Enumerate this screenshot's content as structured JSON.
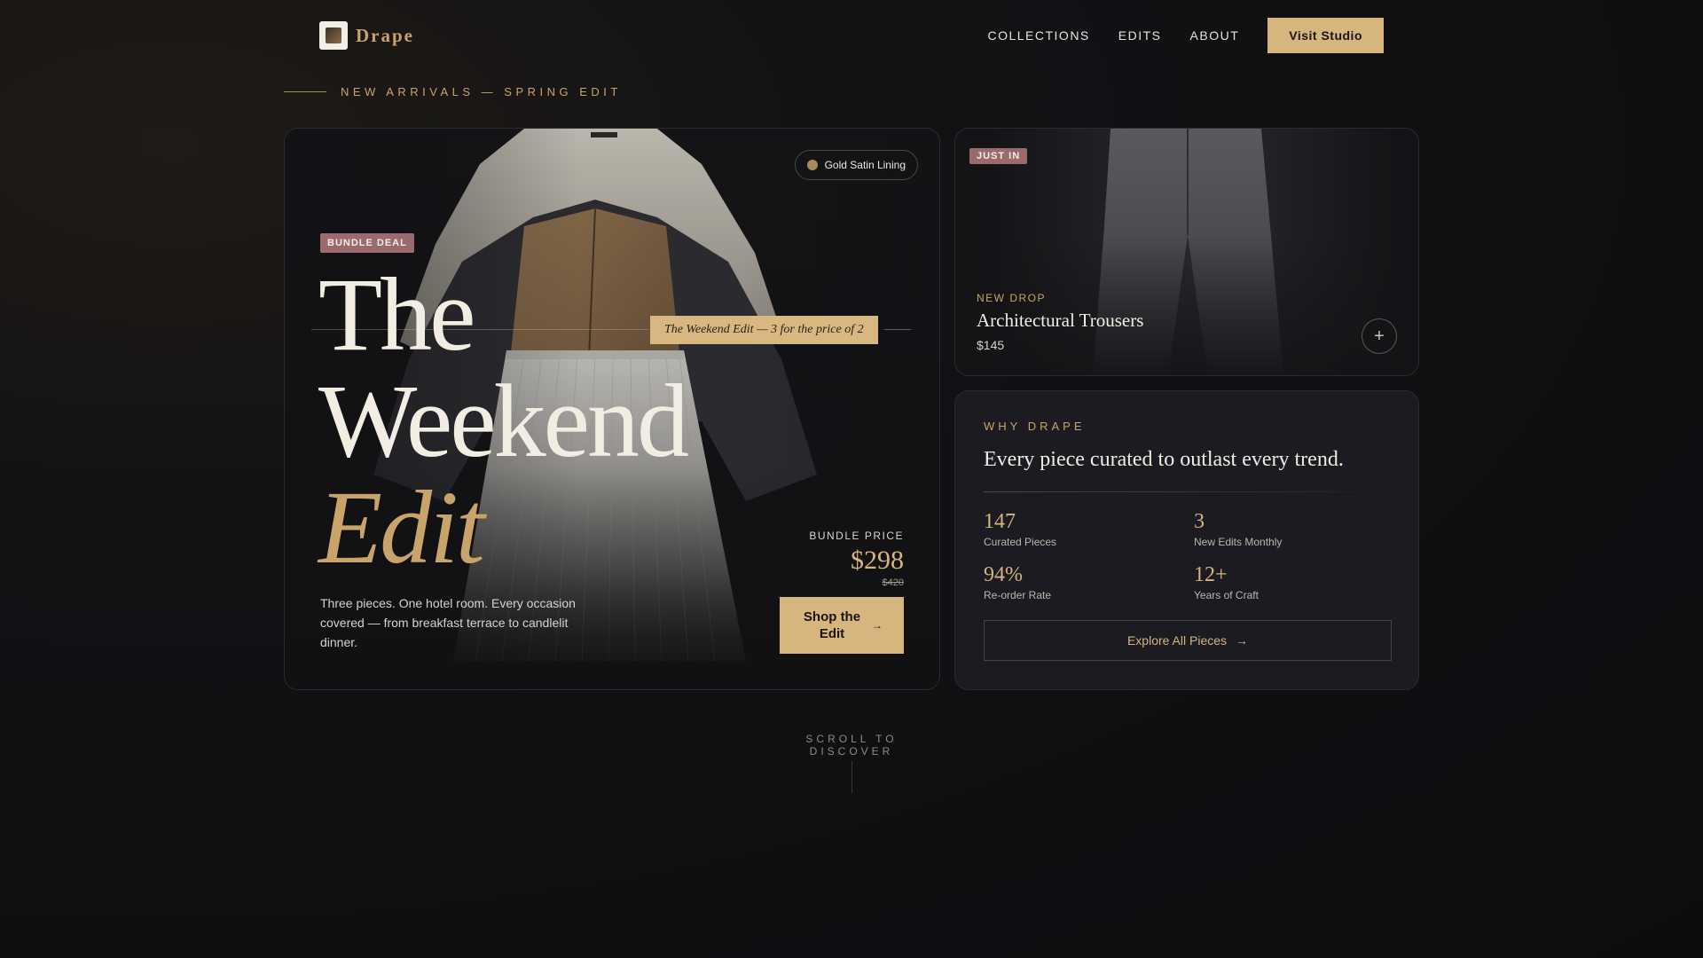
{
  "nav": {
    "brand": "Drape",
    "links": [
      "COLLECTIONS",
      "EDITS",
      "ABOUT"
    ],
    "cta": "Visit Studio"
  },
  "eyebrow": "NEW ARRIVALS — SPRING EDIT",
  "hero": {
    "chip": "Gold Satin Lining",
    "badge": "BUNDLE DEAL",
    "headline_line1": "The",
    "headline_line2": "Weekend",
    "headline_line3": "Edit",
    "tagline": "The Weekend Edit — 3 for the price of 2",
    "description": "Three pieces. One hotel room. Every occasion covered — from breakfast terrace to candlelit dinner.",
    "price_label": "BUNDLE PRICE",
    "price": "$298",
    "price_old": "$420",
    "cta": "Shop the Edit",
    "cta_icon": "arrow-right-icon"
  },
  "drop": {
    "badge": "JUST IN",
    "label": "NEW DROP",
    "title": "Architectural Trousers",
    "price": "$145",
    "action_icon": "plus-icon",
    "action_symbol": "+"
  },
  "why": {
    "eyebrow": "WHY DRAPE",
    "title": "Every piece curated to outlast every trend.",
    "stats": [
      {
        "value": "147",
        "label": "Curated Pieces"
      },
      {
        "value": "3",
        "label": "New Edits Monthly"
      },
      {
        "value": "94%",
        "label": "Re-order Rate"
      },
      {
        "value": "12+",
        "label": "Years of Craft"
      }
    ],
    "cta": "Explore All Pieces",
    "cta_icon": "arrow-right-icon"
  },
  "scroll": "SCROLL TO DISCOVER",
  "colors": {
    "accent_gold": "#d6b57e",
    "badge_rose": "#9a6a6d",
    "background": "#0f0f12",
    "card_dark": "#1b1b21"
  }
}
